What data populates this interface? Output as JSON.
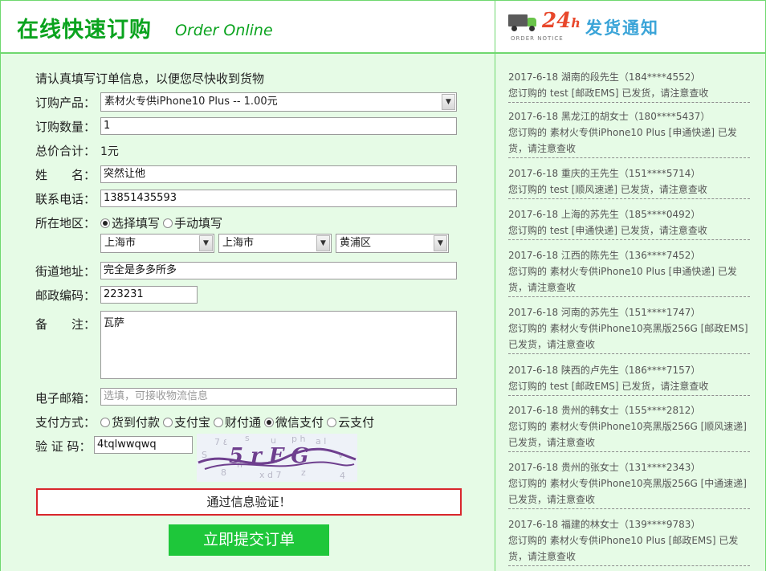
{
  "header": {
    "title_cn": "在线快速订购",
    "title_en": "Order Online",
    "notice_small": "ORDER NOTICE",
    "logo_24": "24",
    "logo_h": "h",
    "ship_title": "发货通知"
  },
  "form": {
    "intro": "请认真填写订单信息，以便您尽快收到货物",
    "product_label": "订购产品：",
    "product_value": "素材火专供iPhone10 Plus -- 1.00元",
    "quantity_label": "订购数量：",
    "quantity_value": "1",
    "total_label": "总价合计：",
    "total_value": "1元",
    "name_label": "姓　　名：",
    "name_value": "突然让他",
    "phone_label": "联系电话：",
    "phone_value": "13851435593",
    "region_label": "所在地区：",
    "region_opt_select": "选择填写",
    "region_opt_manual": "手动填写",
    "province": "上海市",
    "city": "上海市",
    "district": "黄浦区",
    "street_label": "街道地址：",
    "street_value": "完全是多多所多",
    "zip_label": "邮政编码：",
    "zip_value": "223231",
    "remark_label": "备　　注：",
    "remark_value": "瓦萨",
    "email_label": "电子邮箱：",
    "email_placeholder": "选填，可接收物流信息",
    "pay_label": "支付方式：",
    "pay_options": [
      "货到付款",
      "支付宝",
      "财付通",
      "微信支付",
      "云支付"
    ],
    "pay_selected_index": 3,
    "captcha_label": "验 证 码：",
    "captcha_value": "4tqlwwqwq",
    "captcha_text": "5 r F G",
    "verify_msg": "通过信息验证！",
    "submit_label": "立即提交订单"
  },
  "notices": [
    {
      "line1": "2017-6-18 湖南的段先生（184****4552）",
      "line2": "您订购的 test [邮政EMS] 已发货，请注意查收"
    },
    {
      "line1": "2017-6-18 黑龙江的胡女士（180****5437）",
      "line2": "您订购的 素材火专供iPhone10 Plus [申通快递] 已发",
      "line3": "货，请注意查收"
    },
    {
      "line1": "2017-6-18 重庆的王先生（151****5714）",
      "line2": "您订购的 test [顺风速递] 已发货，请注意查收"
    },
    {
      "line1": "2017-6-18 上海的苏先生（185****0492）",
      "line2": "您订购的 test [申通快递] 已发货，请注意查收"
    },
    {
      "line1": "2017-6-18 江西的陈先生（136****7452）",
      "line2": "您订购的 素材火专供iPhone10 Plus [申通快递] 已发",
      "line3": "货，请注意查收"
    },
    {
      "line1": "2017-6-18 河南的苏先生（151****1747）",
      "line2": "您订购的 素材火专供iPhone10亮黑版256G [邮政EMS]",
      "line3": "已发货，请注意查收"
    },
    {
      "line1": "2017-6-18 陕西的卢先生（186****7157）",
      "line2": "您订购的 test [邮政EMS] 已发货，请注意查收"
    },
    {
      "line1": "2017-6-18 贵州的韩女士（155****2812）",
      "line2": "您订购的 素材火专供iPhone10亮黑版256G [顺风速递]",
      "line3": "已发货，请注意查收"
    },
    {
      "line1": "2017-6-18 贵州的张女士（131****2343）",
      "line2": "您订购的 素材火专供iPhone10亮黑版256G [中通速递]",
      "line3": "已发货，请注意查收"
    },
    {
      "line1": "2017-6-18 福建的林女士（139****9783）",
      "line2": "您订购的 素材火专供iPhone10 Plus [邮政EMS] 已发",
      "line3": "货，请注意查收"
    }
  ],
  "colors": {
    "brand_green": "#0aa31e",
    "panel_bg": "#e6fbe6",
    "submit_bg": "#1ec73a",
    "error_border": "#d9262c"
  }
}
